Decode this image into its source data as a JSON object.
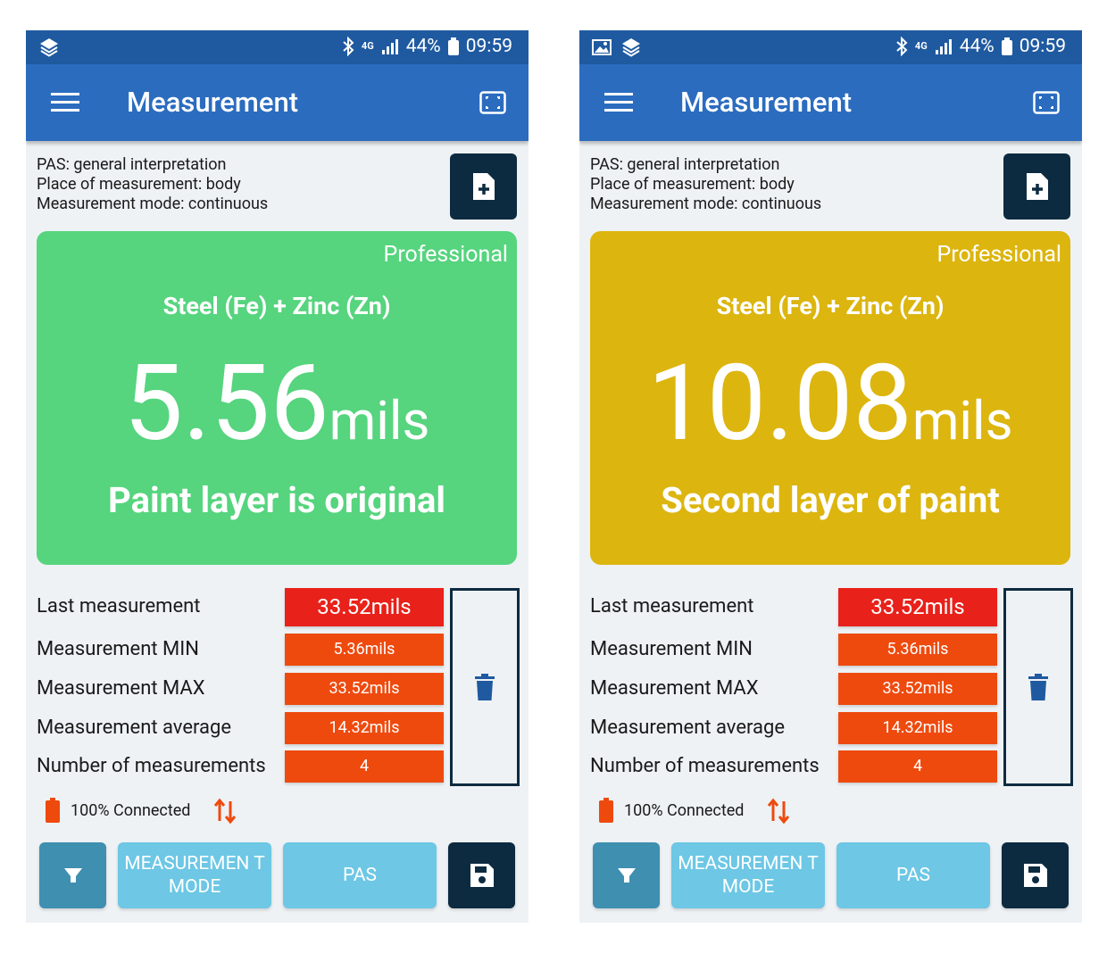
{
  "screens": [
    {
      "status": {
        "battery_pct": "44%",
        "time": "09:59",
        "network": "4G"
      },
      "app_title": "Measurement",
      "info": {
        "pas": "PAS: general interpretation",
        "place": "Place of measurement: body",
        "mode": "Measurement mode: continuous"
      },
      "card": {
        "color": "#56d47e",
        "level": "Professional",
        "material": "Steel (Fe) + Zinc (Zn)",
        "value": "5.56",
        "unit": "mils",
        "result": "Paint layer is original"
      },
      "stats": {
        "last_label": "Last measurement",
        "last_value": "33.52mils",
        "min_label": "Measurement MIN",
        "min_value": "5.36mils",
        "max_label": "Measurement MAX",
        "max_value": "33.52mils",
        "avg_label": "Measurement average",
        "avg_value": "14.32mils",
        "count_label": "Number of measurements",
        "count_value": "4"
      },
      "connection": {
        "battery": "100%",
        "status": "Connected"
      },
      "buttons": {
        "mode": "MEASUREMEN T MODE",
        "pas": "PAS"
      }
    },
    {
      "status": {
        "battery_pct": "44%",
        "time": "09:59",
        "network": "4G"
      },
      "app_title": "Measurement",
      "info": {
        "pas": "PAS: general interpretation",
        "place": "Place of measurement: body",
        "mode": "Measurement mode: continuous"
      },
      "card": {
        "color": "#dcb50f",
        "level": "Professional",
        "material": "Steel (Fe) + Zinc (Zn)",
        "value": "10.08",
        "unit": "mils",
        "result": "Second layer of paint"
      },
      "stats": {
        "last_label": "Last measurement",
        "last_value": "33.52mils",
        "min_label": "Measurement MIN",
        "min_value": "5.36mils",
        "max_label": "Measurement MAX",
        "max_value": "33.52mils",
        "avg_label": "Measurement average",
        "avg_value": "14.32mils",
        "count_label": "Number of measurements",
        "count_value": "4"
      },
      "connection": {
        "battery": "100%",
        "status": "Connected"
      },
      "buttons": {
        "mode": "MEASUREMEN T MODE",
        "pas": "PAS"
      }
    }
  ]
}
